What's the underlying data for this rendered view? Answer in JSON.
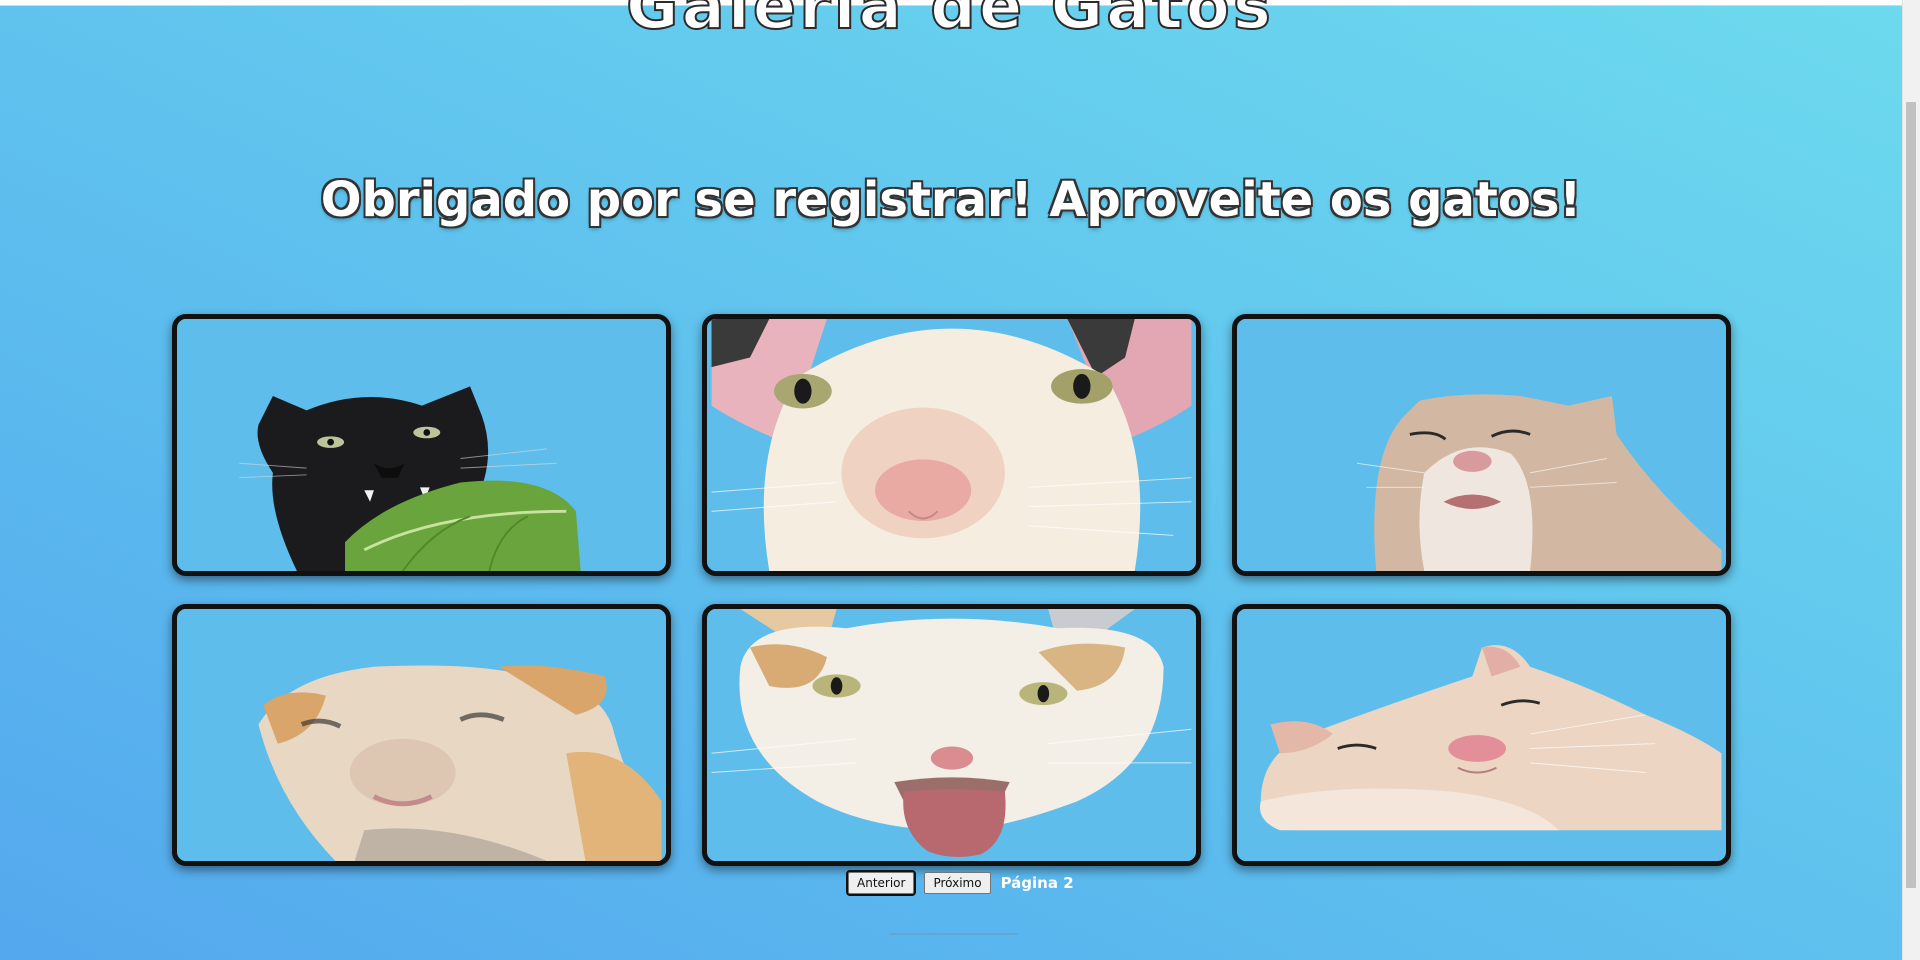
{
  "header": {
    "title": "Galeria de Gatos",
    "message": "Obrigado por se registrar! Aproveite os gatos!"
  },
  "gallery": {
    "images": [
      {
        "subject": "black cat with leaf",
        "icon": "black-cat-leaf-image"
      },
      {
        "subject": "hairless white cat close-up",
        "icon": "white-cat-nose-image"
      },
      {
        "subject": "cream cat face",
        "icon": "cream-cat-image"
      },
      {
        "subject": "blurry orange-white cat",
        "icon": "blurry-cat-image"
      },
      {
        "subject": "white cat with tongue out",
        "icon": "tongue-cat-image"
      },
      {
        "subject": "cream cat lying down",
        "icon": "lying-cat-image"
      }
    ]
  },
  "pagination": {
    "prev_label": "Anterior",
    "next_label": "Próximo",
    "page_label": "Página 2"
  },
  "colors": {
    "background_start": "#54a8ee",
    "background_end": "#6ddaee",
    "card_border": "#111111",
    "card_bg": "#5ebdea"
  }
}
